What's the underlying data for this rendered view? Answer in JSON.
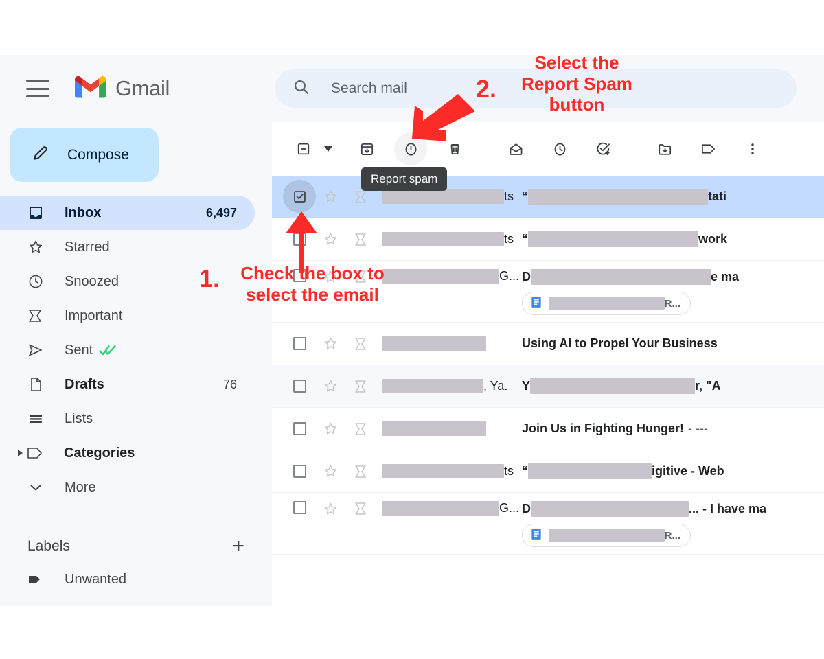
{
  "app": {
    "brand": "Gmail",
    "accent_blue": "#c2e7ff",
    "selected_row_blue": "#c2dbff",
    "annotation_red": "#fb2c28"
  },
  "header": {
    "menu_icon": "hamburger-icon",
    "logo_icon": "gmail-logo-icon"
  },
  "search": {
    "icon": "search-icon",
    "placeholder": "Search mail",
    "value": ""
  },
  "sidebar": {
    "compose": {
      "label": "Compose",
      "icon": "pencil-icon"
    },
    "items": [
      {
        "label": "Inbox",
        "icon": "inbox-icon",
        "count": "6,497",
        "active": true,
        "bold": true
      },
      {
        "label": "Starred",
        "icon": "star-icon",
        "count": "",
        "active": false,
        "bold": false
      },
      {
        "label": "Snoozed",
        "icon": "clock-icon",
        "count": "",
        "active": false,
        "bold": false
      },
      {
        "label": "Important",
        "icon": "important-icon",
        "count": "",
        "active": false,
        "bold": false
      },
      {
        "label": "Sent",
        "icon": "send-icon",
        "count": "",
        "active": false,
        "bold": false,
        "suffix_icon": "double-check-icon"
      },
      {
        "label": "Drafts",
        "icon": "draft-icon",
        "count": "76",
        "active": false,
        "bold": true
      },
      {
        "label": "Lists",
        "icon": "lists-icon",
        "count": "",
        "active": false,
        "bold": false
      },
      {
        "label": "Categories",
        "icon": "label-icon",
        "count": "",
        "active": false,
        "bold": true,
        "expandable": true
      },
      {
        "label": "More",
        "icon": "chevron-down-icon",
        "count": "",
        "active": false,
        "bold": false
      }
    ],
    "labels_section": {
      "title": "Labels",
      "add_icon": "plus-icon"
    },
    "labels": [
      {
        "label": "Unwanted",
        "icon": "label-filled-icon"
      }
    ]
  },
  "toolbar": {
    "select_all": {
      "name": "select-all-checkbox",
      "icon": "checkbox-indeterminate-icon"
    },
    "select_all_caret": {
      "name": "select-all-dropdown",
      "icon": "caret-down-icon"
    },
    "buttons": [
      {
        "name": "archive-button",
        "icon": "archive-icon",
        "highlighted": false
      },
      {
        "name": "report-spam-button",
        "icon": "report-spam-icon",
        "highlighted": true
      },
      {
        "name": "delete-button",
        "icon": "trash-icon",
        "highlighted": false
      }
    ],
    "buttons2": [
      {
        "name": "mark-unread-button",
        "icon": "mail-open-icon",
        "highlighted": false
      },
      {
        "name": "snooze-button",
        "icon": "clock-icon",
        "highlighted": false
      },
      {
        "name": "add-to-tasks-button",
        "icon": "task-add-icon",
        "highlighted": false
      }
    ],
    "buttons3": [
      {
        "name": "move-to-button",
        "icon": "folder-move-icon",
        "highlighted": false
      },
      {
        "name": "labels-button",
        "icon": "label-outline-icon",
        "highlighted": false
      },
      {
        "name": "more-button",
        "icon": "more-vertical-icon",
        "highlighted": false
      }
    ],
    "tooltip": "Report spam"
  },
  "mail_list": {
    "rows": [
      {
        "selected": true,
        "tinted": false,
        "checked": true,
        "tall": false,
        "sender_redacted_width": 178,
        "sender_tail": "ts",
        "subject_prefix": "“",
        "subject_redacted_width": 262,
        "subject_tail": "tati",
        "snippet": "",
        "attachment": null
      },
      {
        "selected": false,
        "tinted": false,
        "checked": false,
        "tall": false,
        "sender_redacted_width": 178,
        "sender_tail": "ts",
        "subject_prefix": "“",
        "subject_redacted_width": 248,
        "subject_tail": "work",
        "snippet": "",
        "attachment": null
      },
      {
        "selected": false,
        "tinted": false,
        "checked": false,
        "tall": true,
        "sender_redacted_width": 188,
        "sender_tail": "G...",
        "subject_prefix": "D",
        "subject_redacted_width": 262,
        "subject_tail": "e ma",
        "snippet": "",
        "attachment": {
          "icon": "google-docs-icon",
          "redacted_width": 172,
          "tail": "R..."
        }
      },
      {
        "selected": false,
        "tinted": false,
        "checked": false,
        "tall": false,
        "sender_redacted_width": 152,
        "sender_tail": "",
        "subject_prefix": "",
        "subject_redacted_width": 0,
        "subject_tail": "",
        "subject_text": "Using AI to Propel Your Business",
        "snippet": "",
        "attachment": null
      },
      {
        "selected": false,
        "tinted": true,
        "checked": false,
        "tall": false,
        "sender_redacted_width": 148,
        "sender_tail": ", Ya.",
        "subject_prefix": "Y",
        "subject_redacted_width": 240,
        "subject_tail": "r, \"A",
        "snippet": "",
        "attachment": null
      },
      {
        "selected": false,
        "tinted": false,
        "checked": false,
        "tall": false,
        "sender_redacted_width": 152,
        "sender_tail": "",
        "subject_prefix": "",
        "subject_redacted_width": 0,
        "subject_tail": "",
        "subject_text": "Join Us in Fighting Hunger!",
        "snippet": "- ---",
        "attachment": null
      },
      {
        "selected": false,
        "tinted": false,
        "checked": false,
        "tall": false,
        "sender_redacted_width": 178,
        "sender_tail": "ts",
        "subject_prefix": "“",
        "subject_redacted_width": 180,
        "subject_tail": "igitive - Web",
        "snippet": "",
        "attachment": null
      },
      {
        "selected": false,
        "tinted": false,
        "checked": false,
        "tall": true,
        "sender_redacted_width": 188,
        "sender_tail": "G...",
        "subject_prefix": "D",
        "subject_redacted_width": 230,
        "subject_tail": "... - I have ma",
        "snippet": "",
        "attachment": {
          "icon": "google-docs-icon",
          "redacted_width": 172,
          "tail": "R..."
        }
      }
    ]
  },
  "annotations": [
    {
      "id": "step-1",
      "number": "1.",
      "line1": "Check the box to",
      "line2": "select the email",
      "arrow": "arrow-up-icon"
    },
    {
      "id": "step-2",
      "number": "2.",
      "line1": "Select the",
      "line2": "Report Spam",
      "line3": "button",
      "arrow": "arrow-down-left-icon"
    }
  ]
}
